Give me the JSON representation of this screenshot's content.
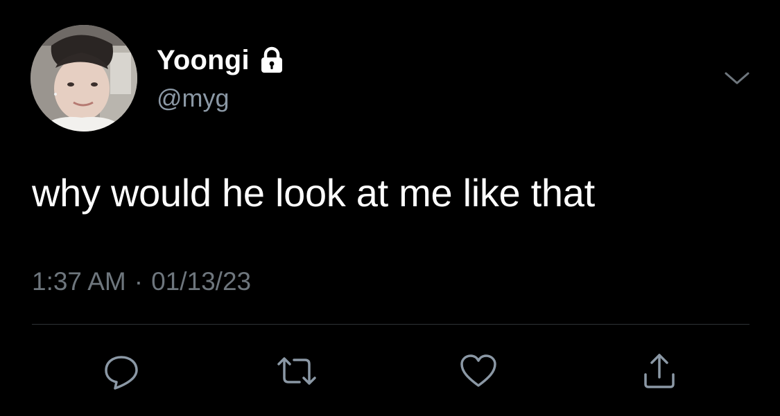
{
  "tweet": {
    "display_name": "Yoongi",
    "handle": "@myg",
    "text": "why would he look at me like that",
    "time": "1:37 AM",
    "separator": "·",
    "date": "01/13/23",
    "protected": true
  },
  "icons": {
    "lock": "lock-icon",
    "more": "chevron-down-icon",
    "reply": "reply-icon",
    "retweet": "retweet-icon",
    "like": "heart-icon",
    "share": "share-icon"
  },
  "colors": {
    "background": "#000000",
    "text_primary": "#ffffff",
    "handle": "#8b98a5",
    "meta": "#6e767d",
    "icon": "#8b98a5",
    "divider": "#2f3336"
  }
}
